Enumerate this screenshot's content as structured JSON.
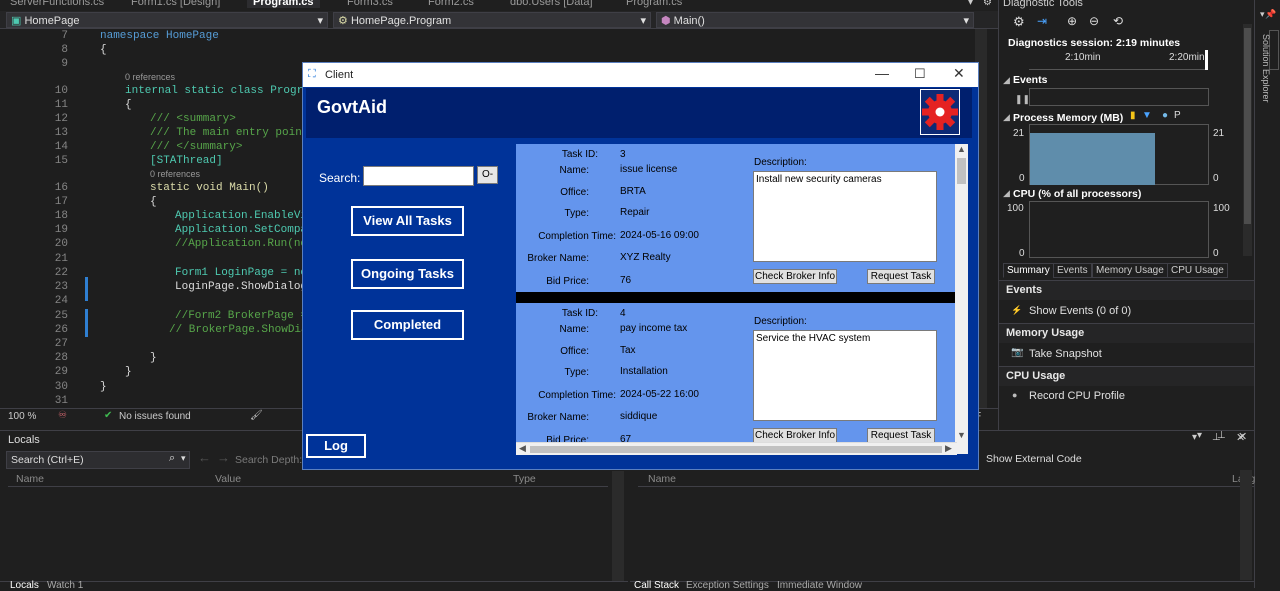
{
  "vs": {
    "tabs": [
      "ServerFunctions.cs",
      "Form1.cs [Design]",
      "Program.cs",
      "Form3.cs",
      "Form2.cs",
      "dbo.Users [Data]",
      "Program.cs"
    ],
    "nav": {
      "project": "HomePage",
      "class": "HomePage.Program",
      "member": "Main()"
    },
    "code_lines": [
      {
        "n": "7",
        "t": "namespace HomePage"
      },
      {
        "n": "8",
        "t": "{"
      },
      {
        "n": "9",
        "t": ""
      },
      {
        "n": "10",
        "t": "internal static class Program"
      },
      {
        "n": "11",
        "t": "{"
      },
      {
        "n": "12",
        "t": "/// <summary>"
      },
      {
        "n": "13",
        "t": "/// The main entry point"
      },
      {
        "n": "14",
        "t": "/// </summary>"
      },
      {
        "n": "15",
        "t": "[STAThread]"
      },
      {
        "n": "16",
        "t": "static void Main()"
      },
      {
        "n": "17",
        "t": "{"
      },
      {
        "n": "18",
        "t": "Application.EnableVi"
      },
      {
        "n": "19",
        "t": "Application.SetCompa"
      },
      {
        "n": "20",
        "t": "//Application.Run(ne"
      },
      {
        "n": "21",
        "t": ""
      },
      {
        "n": "22",
        "t": "Form1 LoginPage = ne"
      },
      {
        "n": "23",
        "t": "LoginPage.ShowDialog"
      },
      {
        "n": "24",
        "t": ""
      },
      {
        "n": "25",
        "t": "//Form2 BrokerPage ="
      },
      {
        "n": "26",
        "t": "// BrokerPage.ShowDia"
      },
      {
        "n": "27",
        "t": ""
      },
      {
        "n": "28",
        "t": "}"
      },
      {
        "n": "29",
        "t": "}"
      },
      {
        "n": "30",
        "t": "}"
      },
      {
        "n": "31",
        "t": ""
      }
    ],
    "references": "0 references",
    "status": {
      "zoom": "100 %",
      "issues": "No issues found"
    }
  },
  "diagnostics": {
    "title": "Diagnostic Tools",
    "session": "Diagnostics session: 2:19 minutes",
    "timeline": [
      "2:10min",
      "2:20min"
    ],
    "events_label": "Events",
    "memory_label": "Process Memory (MB)",
    "memory_max": "21",
    "memory_min": "0",
    "cpu_label": "CPU (% of all processors)",
    "cpu_max": "100",
    "cpu_min": "0",
    "tabs": [
      "Summary",
      "Events",
      "Memory Usage",
      "CPU Usage"
    ],
    "sections": [
      {
        "heading": "Events",
        "item": "Show Events (0 of 0)"
      },
      {
        "heading": "Memory Usage",
        "item": "Take Snapshot"
      },
      {
        "heading": "CPU Usage",
        "item": "Record CPU Profile"
      }
    ],
    "side_label": "Solution Explorer",
    "legend_p": "P"
  },
  "locals": {
    "title": "Locals",
    "search_placeholder": "Search (Ctrl+E)",
    "search_depth": "Search Depth:",
    "columns": [
      "Name",
      "Value",
      "Type"
    ],
    "bottom_tabs": [
      "Locals",
      "Watch 1"
    ]
  },
  "callstack": {
    "show_external": "Show External Code",
    "columns": [
      "Name",
      "Lang"
    ],
    "bottom_tabs": [
      "Call Stack",
      "Exception Settings",
      "Immediate Window"
    ]
  },
  "client": {
    "title": "Client",
    "brand": "GovtAid",
    "search_label": "Search:",
    "search_button": "O-",
    "nav": [
      "View All Tasks",
      "Ongoing Tasks",
      "Completed"
    ],
    "log_button": "Log",
    "field_labels": {
      "id": "Task ID:",
      "name": "Name:",
      "office": "Office:",
      "type": "Type:",
      "completion": "Completion Time:",
      "broker": "Broker Name:",
      "bid": "Bid Price:",
      "description": "Description:",
      "check_broker": "Check Broker Info",
      "request": "Request Task"
    },
    "tasks": [
      {
        "id": "3",
        "name": "issue license",
        "office": "BRTA",
        "type": "Repair",
        "completion": "2024-05-16 09:00",
        "broker": "XYZ Realty",
        "bid": "76",
        "description": "Install new security cameras"
      },
      {
        "id": "4",
        "name": "pay income tax",
        "office": "Tax",
        "type": "Installation",
        "completion": "2024-05-22 16:00",
        "broker": "siddique",
        "bid": "67",
        "description": "Service the HVAC system"
      }
    ]
  }
}
